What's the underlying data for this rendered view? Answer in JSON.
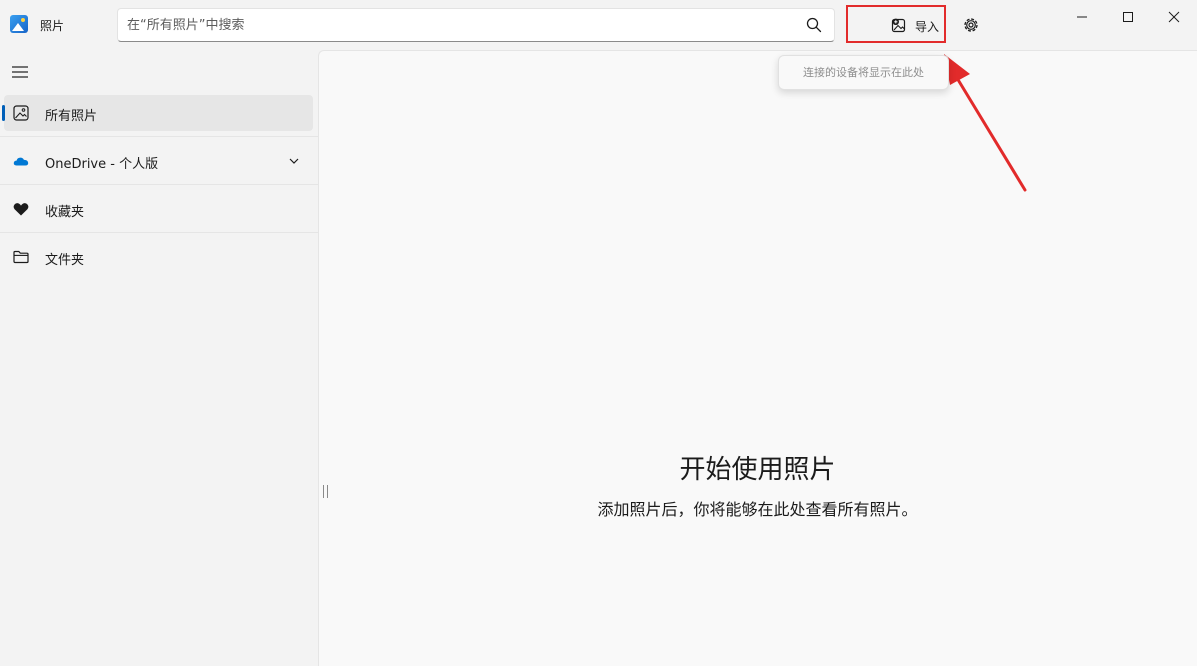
{
  "app": {
    "title": "照片"
  },
  "search": {
    "placeholder": "在“所有照片”中搜索",
    "value": ""
  },
  "toolbar": {
    "import_label": "导入",
    "import_tooltip": "连接的设备将显示在此处"
  },
  "sidebar": {
    "items": [
      {
        "label": "所有照片",
        "icon": "photo-icon",
        "active": true
      },
      {
        "label": "OneDrive - 个人版",
        "icon": "cloud-icon",
        "expandable": true
      },
      {
        "label": "收藏夹",
        "icon": "heart-icon"
      },
      {
        "label": "文件夹",
        "icon": "folder-icon"
      }
    ]
  },
  "main": {
    "empty_title": "开始使用照片",
    "empty_subtitle": "添加照片后，你将能够在此处查看所有照片。"
  },
  "colors": {
    "accent": "#005fb8",
    "highlight_box": "#e22b2b",
    "onedrive": "#0078d4"
  }
}
